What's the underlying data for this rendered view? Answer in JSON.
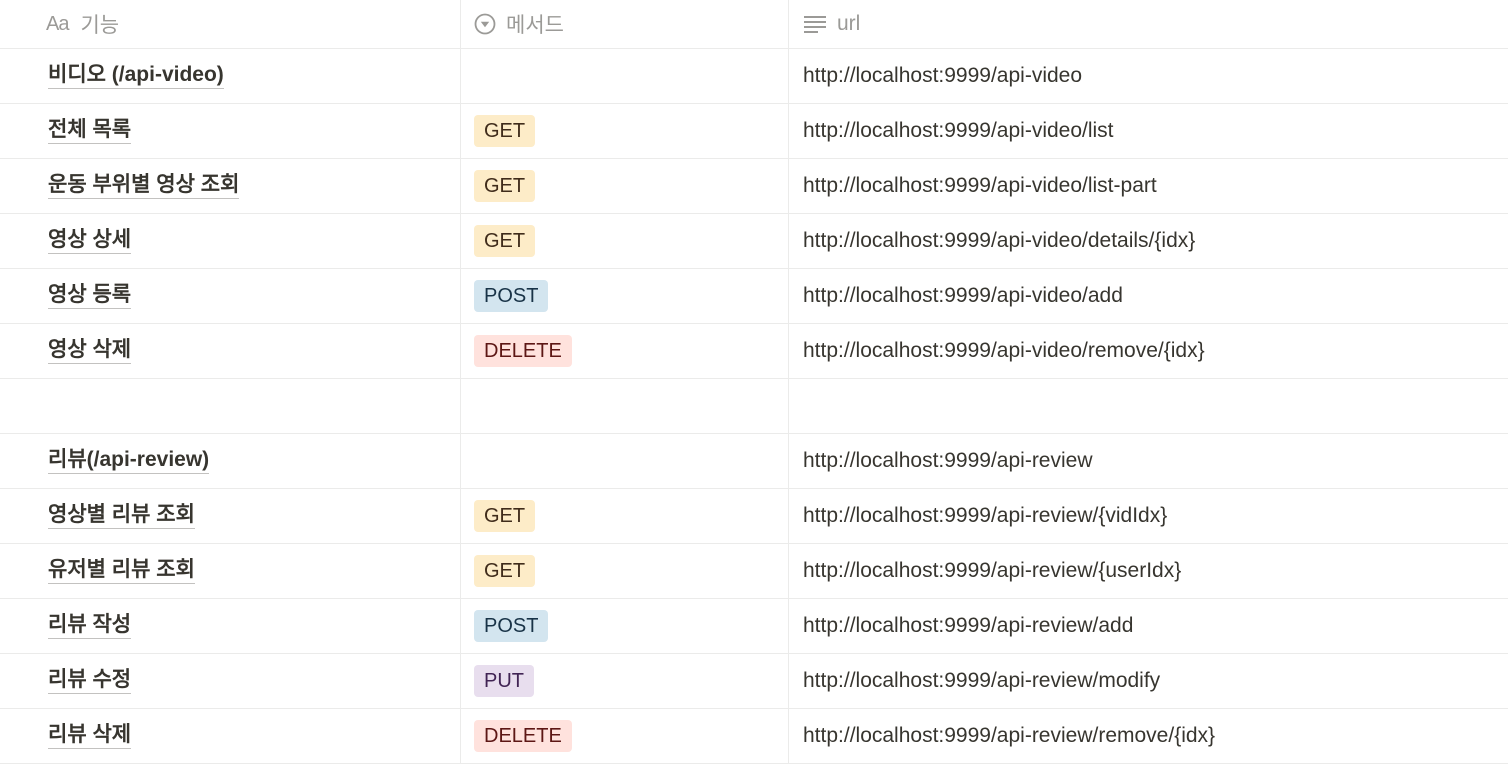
{
  "header": {
    "name_label": "기능",
    "name_icon": "Aa",
    "method_label": "메서드",
    "url_label": "url"
  },
  "colors": {
    "GET_bg": "#fdecc8",
    "GET_fg": "#402c1b",
    "POST_bg": "#d3e5ef",
    "POST_fg": "#183347",
    "DELETE_bg": "#ffe2dd",
    "DELETE_fg": "#5d1715",
    "PUT_bg": "#e8deee",
    "PUT_fg": "#412454"
  },
  "rows": [
    {
      "name": "비디오 (/api-video)",
      "method": "",
      "url": "http://localhost:9999/api-video"
    },
    {
      "name": "전체 목록",
      "method": "GET",
      "url": "http://localhost:9999/api-video/list"
    },
    {
      "name": "운동 부위별 영상 조회",
      "method": "GET",
      "url": "http://localhost:9999/api-video/list-part"
    },
    {
      "name": "영상 상세",
      "method": "GET",
      "url": "http://localhost:9999/api-video/details/{idx}"
    },
    {
      "name": "영상 등록",
      "method": "POST",
      "url": "http://localhost:9999/api-video/add"
    },
    {
      "name": "영상 삭제",
      "method": "DELETE",
      "url": "http://localhost:9999/api-video/remove/{idx}"
    },
    {
      "name": "",
      "method": "",
      "url": ""
    },
    {
      "name": "리뷰(/api-review)",
      "method": "",
      "url": "http://localhost:9999/api-review"
    },
    {
      "name": "영상별 리뷰 조회",
      "method": "GET",
      "url": "http://localhost:9999/api-review/{vidIdx}"
    },
    {
      "name": "유저별 리뷰 조회",
      "method": "GET",
      "url": "http://localhost:9999/api-review/{userIdx}"
    },
    {
      "name": "리뷰 작성",
      "method": "POST",
      "url": "http://localhost:9999/api-review/add"
    },
    {
      "name": "리뷰 수정",
      "method": "PUT",
      "url": "http://localhost:9999/api-review/modify"
    },
    {
      "name": "리뷰 삭제",
      "method": "DELETE",
      "url": "http://localhost:9999/api-review/remove/{idx}"
    }
  ]
}
